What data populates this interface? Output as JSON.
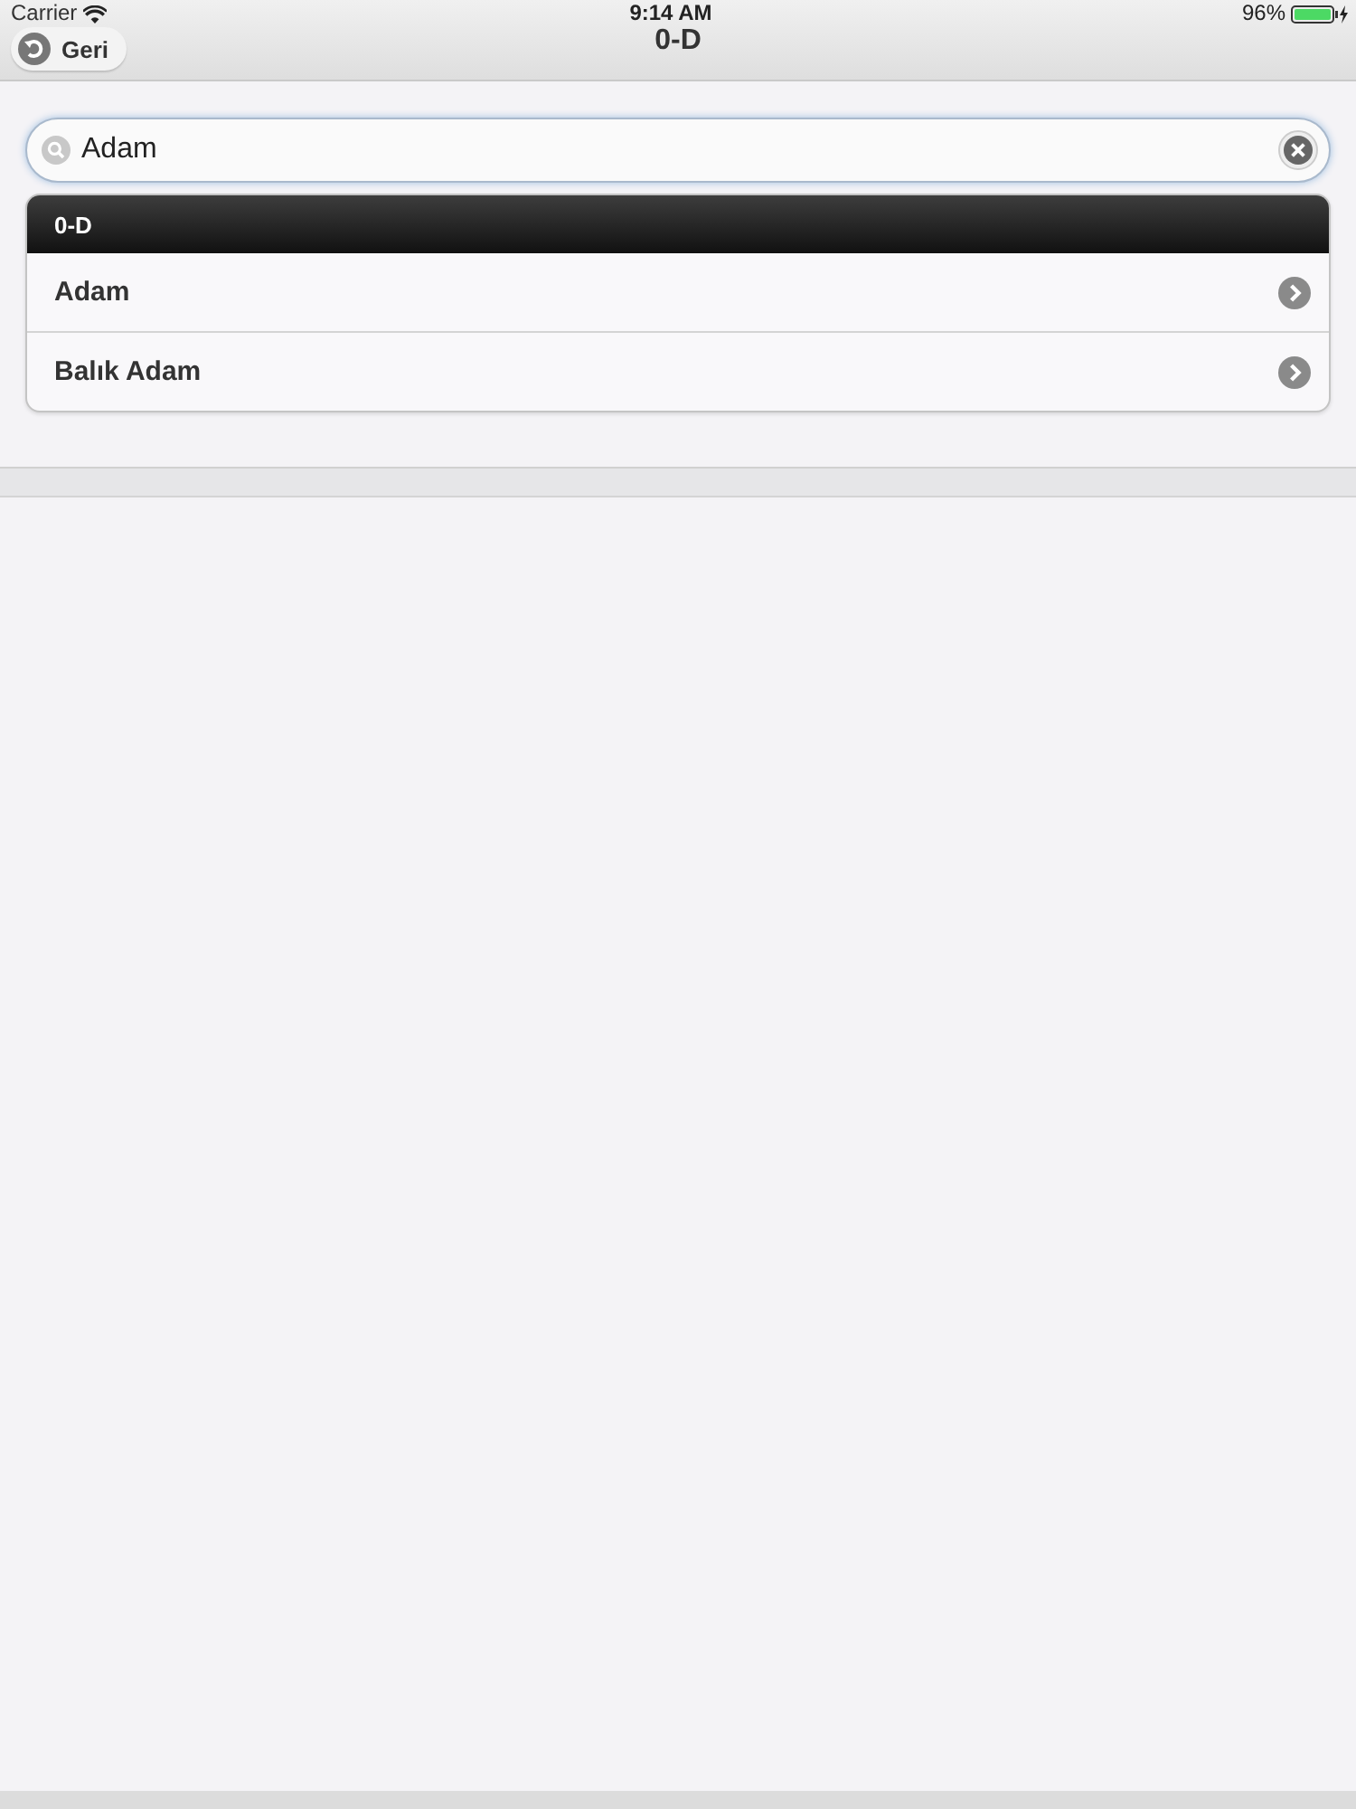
{
  "status_bar": {
    "carrier": "Carrier",
    "time": "9:14 AM",
    "battery": "96%"
  },
  "header": {
    "title": "0-D",
    "back_button": "Geri"
  },
  "search": {
    "value": "Adam"
  },
  "list": {
    "divider": "0-D",
    "items": [
      {
        "label": "Adam"
      },
      {
        "label": "Balık Adam"
      }
    ]
  }
}
